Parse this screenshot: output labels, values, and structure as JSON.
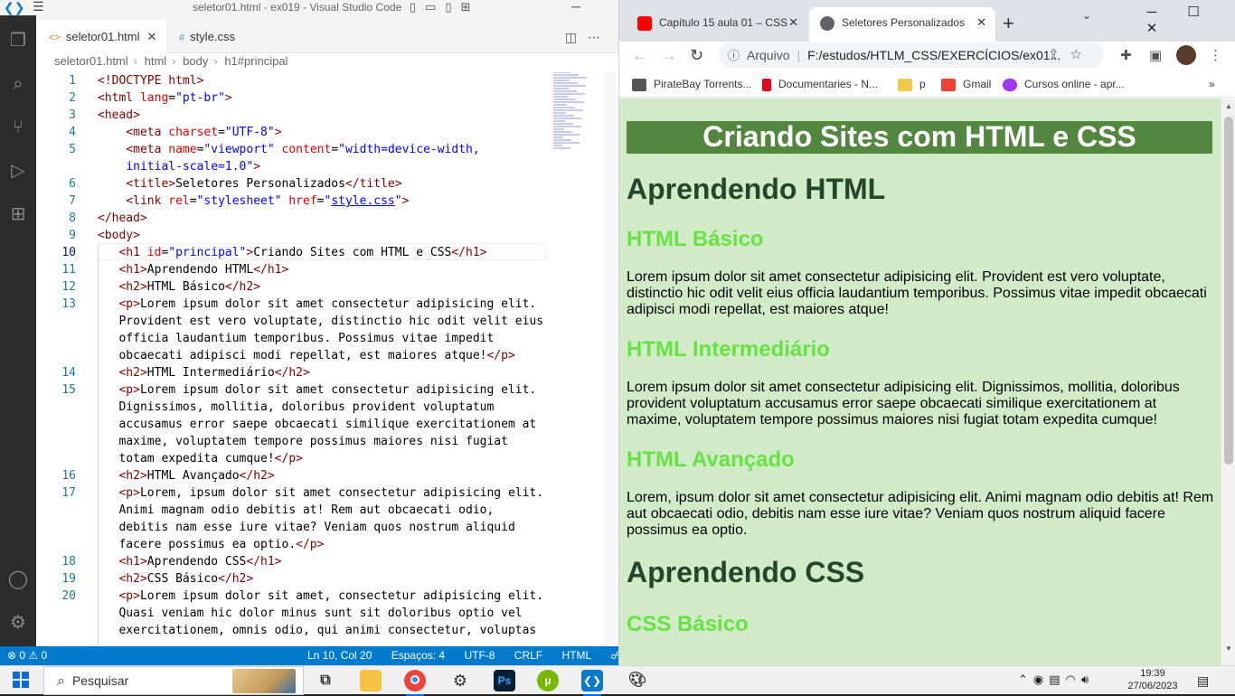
{
  "vscode": {
    "title": "seletor01.html - ex019 - Visual Studio Code",
    "tabs": [
      {
        "label": "seletor01.html",
        "icon": "<>"
      },
      {
        "label": "style.css",
        "icon": "#"
      }
    ],
    "breadcrumb": [
      "seletor01.html",
      "html",
      "body",
      "h1#principal"
    ],
    "lines": [
      {
        "n": "1",
        "html": "<span class='tag'>&lt;!DOCTYPE html&gt;</span>"
      },
      {
        "n": "2",
        "html": "<span class='tag'>&lt;html</span> <span class='attr'>lang</span>=<span class='val'>\"pt-br\"</span><span class='tag'>&gt;</span>"
      },
      {
        "n": "3",
        "html": "<span class='tag'>&lt;head&gt;</span>"
      },
      {
        "n": "4",
        "html": "    <span class='tag'>&lt;meta</span> <span class='attr'>charset</span>=<span class='val'>\"UTF-8\"</span><span class='tag'>&gt;</span>"
      },
      {
        "n": "5",
        "html": "    <span class='tag'>&lt;meta</span> <span class='attr'>name</span>=<span class='val'>\"viewport\"</span> <span class='attr'>content</span>=<span class='val'>\"width=device-width,</span>"
      },
      {
        "n": "",
        "html": "    <span class='val'>initial-scale=1.0\"</span><span class='tag'>&gt;</span>"
      },
      {
        "n": "6",
        "html": "    <span class='tag'>&lt;title&gt;</span>Seletores Personalizados<span class='tag'>&lt;/title&gt;</span>"
      },
      {
        "n": "7",
        "html": "    <span class='tag'>&lt;link</span> <span class='attr'>rel</span>=<span class='val'>\"stylesheet\"</span> <span class='attr'>href</span>=<span class='val'>\"<span class='link'>style.css</span>\"</span><span class='tag'>&gt;</span>"
      },
      {
        "n": "8",
        "html": "<span class='tag'>&lt;/head&gt;</span>"
      },
      {
        "n": "9",
        "html": "<span class='tag'>&lt;body&gt;</span>"
      },
      {
        "n": "10",
        "html": "   <span class='tag'>&lt;h1</span> <span class='attr'>id</span>=<span class='val'>\"principal\"</span><span class='tag'>&gt;</span>Criando Sites com HTML e CSS<span class='tag'>&lt;/h1&gt;</span>"
      },
      {
        "n": "11",
        "html": "   <span class='tag'>&lt;h1&gt;</span>Aprendendo HTML<span class='tag'>&lt;/h1&gt;</span>"
      },
      {
        "n": "12",
        "html": "   <span class='tag'>&lt;h2&gt;</span>HTML Básico<span class='tag'>&lt;/h2&gt;</span>"
      },
      {
        "n": "13",
        "html": "   <span class='tag'>&lt;p&gt;</span>Lorem ipsum dolor sit amet consectetur adipisicing elit."
      },
      {
        "n": "",
        "html": "   Provident est vero voluptate, distinctio hic odit velit eius"
      },
      {
        "n": "",
        "html": "   officia laudantium temporibus. Possimus vitae impedit"
      },
      {
        "n": "",
        "html": "   obcaecati adipisci modi repellat, est maiores atque!<span class='tag'>&lt;/p&gt;</span>"
      },
      {
        "n": "14",
        "html": "   <span class='tag'>&lt;h2&gt;</span>HTML Intermediário<span class='tag'>&lt;/h2&gt;</span>"
      },
      {
        "n": "15",
        "html": "   <span class='tag'>&lt;p&gt;</span>Lorem ipsum dolor sit amet consectetur adipisicing elit."
      },
      {
        "n": "",
        "html": "   Dignissimos, mollitia, doloribus provident voluptatum"
      },
      {
        "n": "",
        "html": "   accusamus error saepe obcaecati similique exercitationem at"
      },
      {
        "n": "",
        "html": "   maxime, voluptatem tempore possimus maiores nisi fugiat"
      },
      {
        "n": "",
        "html": "   totam expedita cumque!<span class='tag'>&lt;/p&gt;</span>"
      },
      {
        "n": "16",
        "html": "   <span class='tag'>&lt;h2&gt;</span>HTML Avançado<span class='tag'>&lt;/h2&gt;</span>"
      },
      {
        "n": "17",
        "html": "   <span class='tag'>&lt;p&gt;</span>Lorem, ipsum dolor sit amet consectetur adipisicing elit."
      },
      {
        "n": "",
        "html": "   Animi magnam odio debitis at! Rem aut obcaecati odio,"
      },
      {
        "n": "",
        "html": "   debitis nam esse iure vitae? Veniam quos nostrum aliquid"
      },
      {
        "n": "",
        "html": "   facere possimus ea optio.<span class='tag'>&lt;/p&gt;</span>"
      },
      {
        "n": "18",
        "html": "   <span class='tag'>&lt;h1&gt;</span>Aprendendo CSS<span class='tag'>&lt;/h1&gt;</span>"
      },
      {
        "n": "19",
        "html": "   <span class='tag'>&lt;h2&gt;</span>CSS Básico<span class='tag'>&lt;/h2&gt;</span>"
      },
      {
        "n": "20",
        "html": "   <span class='tag'>&lt;p&gt;</span>Lorem ipsum dolor sit amet, consectetur adipisicing elit."
      },
      {
        "n": "",
        "html": "   Quasi veniam hic dolor minus sunt sit doloribus optio vel"
      },
      {
        "n": "",
        "html": "   exercitationem, omnis odio, qui animi consectetur, voluptas"
      }
    ],
    "current_line": "10",
    "status": {
      "errors": "0",
      "warnings": "0",
      "position": "Ln 10, Col 20",
      "spaces": "Espaços: 4",
      "encoding": "UTF-8",
      "eol": "CRLF",
      "language": "HTML"
    }
  },
  "chrome": {
    "tabs": [
      {
        "label": "Capítulo 15 aula 01 – CSS",
        "icon": "youtube-icon",
        "color": "#ff0000"
      },
      {
        "label": "Seletores Personalizados",
        "icon": "globe-icon",
        "color": "#5f6368"
      }
    ],
    "url_scheme": "Arquivo",
    "url": "F:/estudos/HTLM_CSS/EXERCÍCIOS/ex01...",
    "bookmarks": [
      {
        "label": "PirateBay Torrents...",
        "color": "#555555"
      },
      {
        "label": "Documentaries - N...",
        "color": "#e50914"
      },
      {
        "label": "p",
        "color": "#f2c84b"
      },
      {
        "label": "Gmail",
        "color": "#ea4335"
      },
      {
        "label": "Cursos online - apr...",
        "color": "#a435f0"
      }
    ],
    "page": {
      "h1_principal": "Criando Sites com HTML e CSS",
      "h1_html": "Aprendendo HTML",
      "h2_basico": "HTML Básico",
      "p_basico": "Lorem ipsum dolor sit amet consectetur adipisicing elit. Provident est vero voluptate, distinctio hic odit velit eius officia laudantium temporibus. Possimus vitae impedit obcaecati adipisci modi repellat, est maiores atque!",
      "h2_intermediario": "HTML Intermediário",
      "p_intermediario": "Lorem ipsum dolor sit amet consectetur adipisicing elit. Dignissimos, mollitia, doloribus provident voluptatum accusamus error saepe obcaecati similique exercitationem at maxime, voluptatem tempore possimus maiores nisi fugiat totam expedita cumque!",
      "h2_avancado": "HTML Avançado",
      "p_avancado": "Lorem, ipsum dolor sit amet consectetur adipisicing elit. Animi magnam odio debitis at! Rem aut obcaecati odio, debitis nam esse iure vitae? Veniam quos nostrum aliquid facere possimus ea optio.",
      "h1_css": "Aprendendo CSS",
      "h2_css_basico": "CSS Básico"
    },
    "colors": {
      "principal_bg": "#53873f",
      "h1": "#25462a",
      "h2": "#66e243",
      "page_bg": "#d1ebc8"
    }
  },
  "taskbar": {
    "search_placeholder": "Pesquisar",
    "time": "19:39",
    "date": "27/06/2023"
  }
}
